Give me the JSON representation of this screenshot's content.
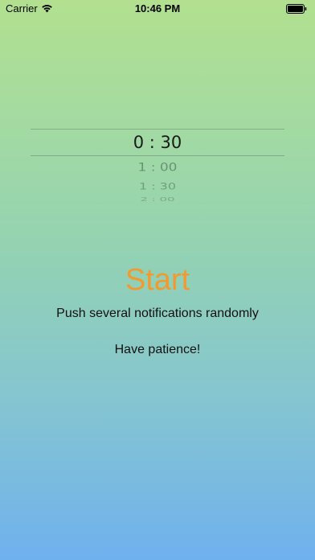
{
  "status_bar": {
    "carrier": "Carrier",
    "time": "10:46 PM"
  },
  "picker": {
    "selected": "0 : 30",
    "options": [
      "1 : 00",
      "1 : 30",
      "2 : 00"
    ]
  },
  "main": {
    "start_label": "Start",
    "description": "Push several notifications randomly",
    "note": "Have patience!"
  },
  "colors": {
    "accent": "#f29a2e",
    "gradient_top": "#b2e08f",
    "gradient_bottom": "#6fb1ee"
  }
}
